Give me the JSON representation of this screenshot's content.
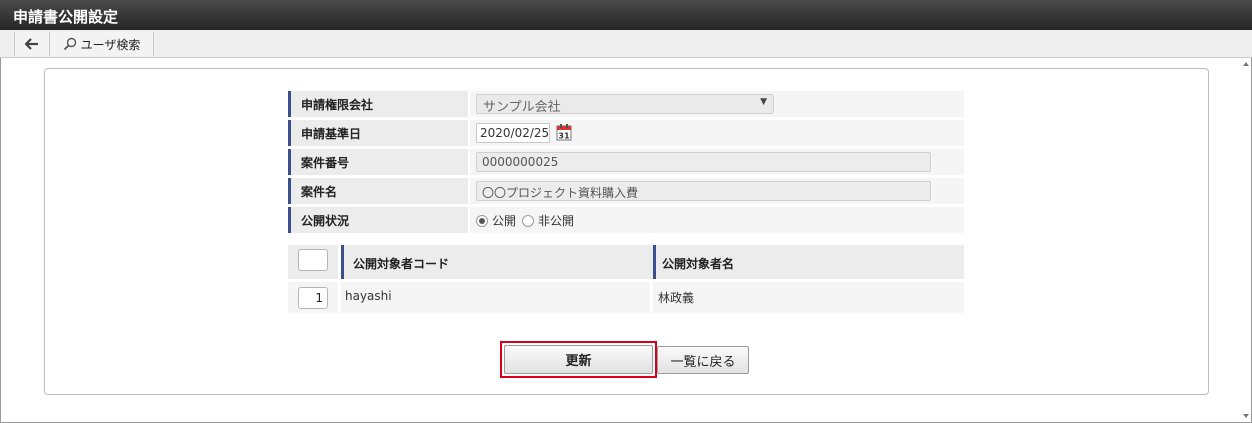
{
  "window": {
    "title": "申請書公開設定"
  },
  "toolbar": {
    "back_icon": "arrow-left-icon",
    "user_search_label": "ユーザ検索",
    "search_icon": "magnifier-icon"
  },
  "form": {
    "company": {
      "label": "申請権限会社",
      "value": "サンプル会社"
    },
    "base_date": {
      "label": "申請基準日",
      "value": "2020/02/25"
    },
    "case_number": {
      "label": "案件番号",
      "value": "0000000025"
    },
    "case_name": {
      "label": "案件名",
      "value": "〇〇プロジェクト資料購入費"
    },
    "publish_status": {
      "label": "公開状況",
      "options": [
        {
          "label": "公開",
          "selected": true
        },
        {
          "label": "非公開",
          "selected": false
        }
      ]
    }
  },
  "target_table": {
    "columns": [
      "公開対象者コード",
      "公開対象者名"
    ],
    "rows": [
      {
        "num": "1",
        "code": "hayashi",
        "name": "林政義"
      }
    ]
  },
  "buttons": {
    "update": "更新",
    "back_to_list": "一覧に戻る"
  },
  "colors": {
    "accent_border": "#3b4f8c",
    "highlight": "#d9001b",
    "titlebar": "#262626"
  }
}
